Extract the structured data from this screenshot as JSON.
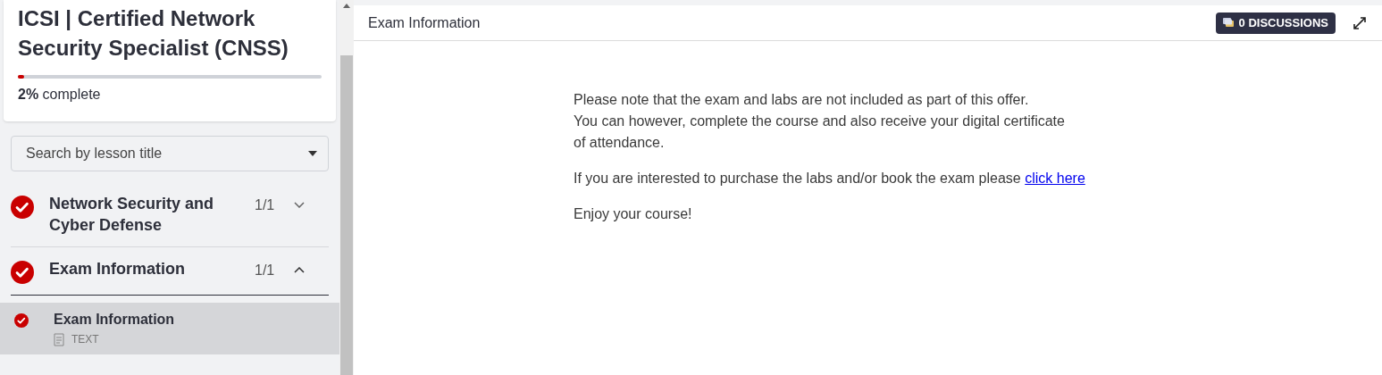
{
  "course": {
    "title": "ICSI | Certified Network Security Specialist (CNSS)",
    "progress": {
      "level": 0.02,
      "label": "**2%** complete"
    }
  },
  "search": {
    "placeholder": "Search by lesson title"
  },
  "sections": [
    {
      "title": "Network Security and Cyber Defense",
      "count": "1/1",
      "completed": true,
      "expanded": false
    },
    {
      "title": "Exam Information",
      "count": "1/1",
      "completed": true,
      "expanded": true,
      "lessons": [
        {
          "title": "Exam Information",
          "type": "TEXT",
          "completed": true,
          "selected": true
        }
      ]
    }
  ],
  "header": {
    "title": "Exam Information",
    "discussions": "0 DISCUSSIONS"
  },
  "content": {
    "paragraphs": [
      {
        "lines": [
          "Please note that the exam and labs are not included as part of this offer.",
          "You can however, complete the course and also receive your digital certificate",
          "of attendance."
        ]
      },
      {
        "text": "If you are interested to purchase the labs and/or book the exam please ",
        "link": "click here"
      },
      {
        "text": "Enjoy your course!"
      }
    ]
  }
}
